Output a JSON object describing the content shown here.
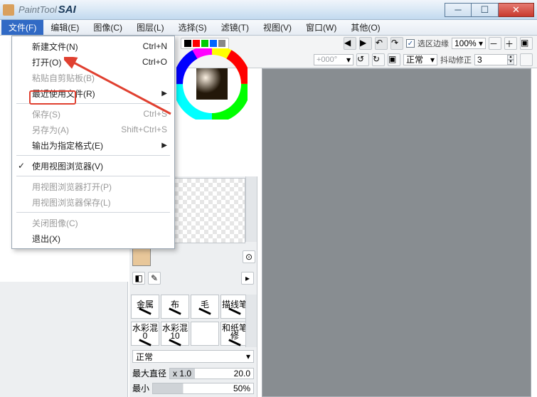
{
  "titlebar": {
    "app_grey": "PaintTool",
    "app_bold": "SAI"
  },
  "menubar": [
    "文件(F)",
    "编辑(E)",
    "图像(C)",
    "图层(L)",
    "选择(S)",
    "滤镜(T)",
    "视图(V)",
    "窗口(W)",
    "其他(O)"
  ],
  "file_menu": {
    "new": {
      "label": "新建文件(N)",
      "shortcut": "Ctrl+N"
    },
    "open": {
      "label": "打开(O)",
      "shortcut": "Ctrl+O"
    },
    "paste_clip": {
      "label": "粘贴自剪贴板(B)"
    },
    "recent": {
      "label": "最近使用文件(R)"
    },
    "save": {
      "label": "保存(S)",
      "shortcut": "Ctrl+S"
    },
    "save_as": {
      "label": "另存为(A)",
      "shortcut": "Shift+Ctrl+S"
    },
    "export": {
      "label": "输出为指定格式(E)"
    },
    "use_viewer": {
      "label": "使用视图浏览器(V)"
    },
    "open_viewer": {
      "label": "用视图浏览器打开(P)"
    },
    "save_viewer": {
      "label": "用视图浏览器保存(L)"
    },
    "close": {
      "label": "关闭图像(C)"
    },
    "exit": {
      "label": "退出(X)"
    }
  },
  "toolbar": {
    "sel_edge_label": "选区边缘",
    "zoom": "100%",
    "angle": "+000°",
    "blend": "正常",
    "stabilizer_label": "抖动修正",
    "stabilizer_value": "3"
  },
  "tools": {
    "row1": [
      "金属",
      "布",
      "毛",
      "描线笔"
    ],
    "row2": [
      "水彩混0",
      "水彩混10",
      "",
      "和纸笔修"
    ]
  },
  "tool_opts": {
    "blend_mode": "正常",
    "max_size_label": "最大直径",
    "max_size_prefix": "x 1.0",
    "max_size_val": "20.0",
    "min_size_label": "最小",
    "min_size_val": "50%"
  }
}
